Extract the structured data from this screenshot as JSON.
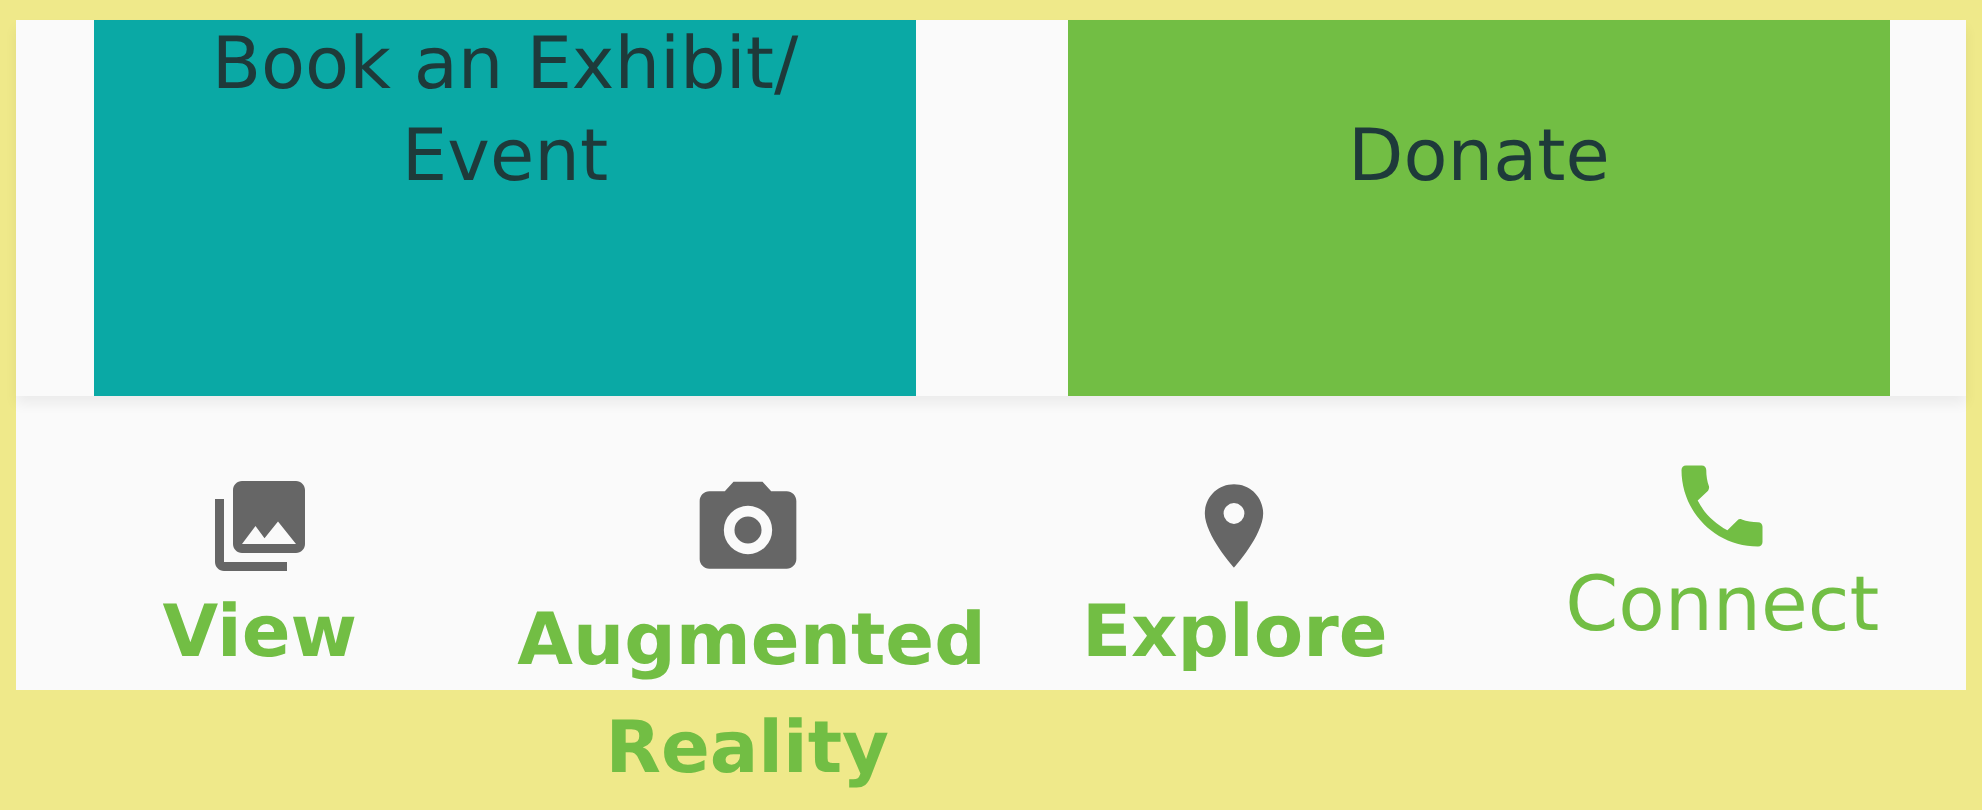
{
  "cards": [
    {
      "lines": [
        "Book an Exhibit/",
        "Event"
      ],
      "color": "#0aa9a5"
    },
    {
      "lines": [
        "Donate"
      ],
      "color": "#72be44"
    }
  ],
  "nav": [
    {
      "kind": "gallery",
      "label": "View",
      "selected": false
    },
    {
      "kind": "camera",
      "label": "Augmented Reality",
      "selected": false
    },
    {
      "kind": "pin",
      "label": "Explore",
      "selected": false
    },
    {
      "kind": "phone",
      "label": "Connect",
      "selected": true
    }
  ]
}
